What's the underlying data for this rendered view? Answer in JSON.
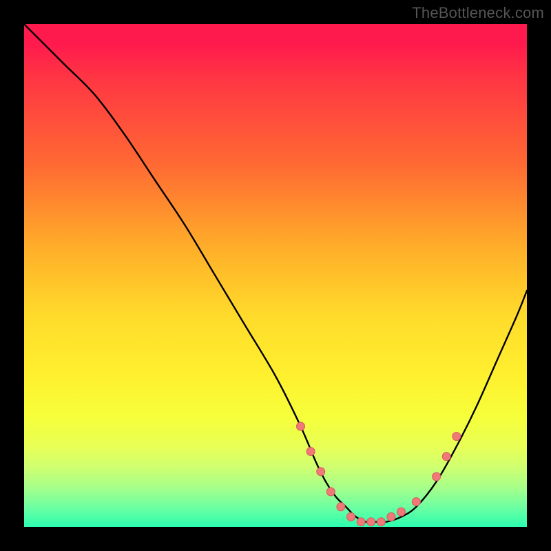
{
  "watermark": "TheBottleneck.com",
  "colors": {
    "curve": "#000000",
    "dot_fill": "#f07878",
    "dot_stroke": "#d85a5a"
  },
  "chart_data": {
    "type": "line",
    "title": "",
    "xlabel": "",
    "ylabel": "",
    "xlim": [
      0,
      100
    ],
    "ylim": [
      0,
      100
    ],
    "grid": false,
    "legend": false,
    "annotations": [
      "TheBottleneck.com"
    ],
    "series": [
      {
        "name": "bottleneck-curve",
        "x": [
          0,
          3,
          8,
          14,
          20,
          26,
          32,
          38,
          44,
          50,
          55,
          58,
          60,
          62,
          64,
          66,
          68,
          70,
          72,
          75,
          78,
          82,
          86,
          90,
          94,
          98,
          100
        ],
        "y": [
          100,
          97,
          92,
          86,
          78,
          69,
          60,
          50,
          40,
          30,
          20,
          13,
          9,
          6,
          4,
          2,
          1,
          1,
          1,
          2,
          4,
          9,
          16,
          24,
          33,
          42,
          47
        ]
      }
    ],
    "dots": {
      "name": "highlight-dots",
      "x": [
        55,
        57,
        59,
        61,
        63,
        65,
        67,
        69,
        71,
        73,
        75,
        78,
        82,
        84,
        86
      ],
      "y": [
        20,
        15,
        11,
        7,
        4,
        2,
        1,
        1,
        1,
        2,
        3,
        5,
        10,
        14,
        18
      ],
      "r": 6
    }
  }
}
